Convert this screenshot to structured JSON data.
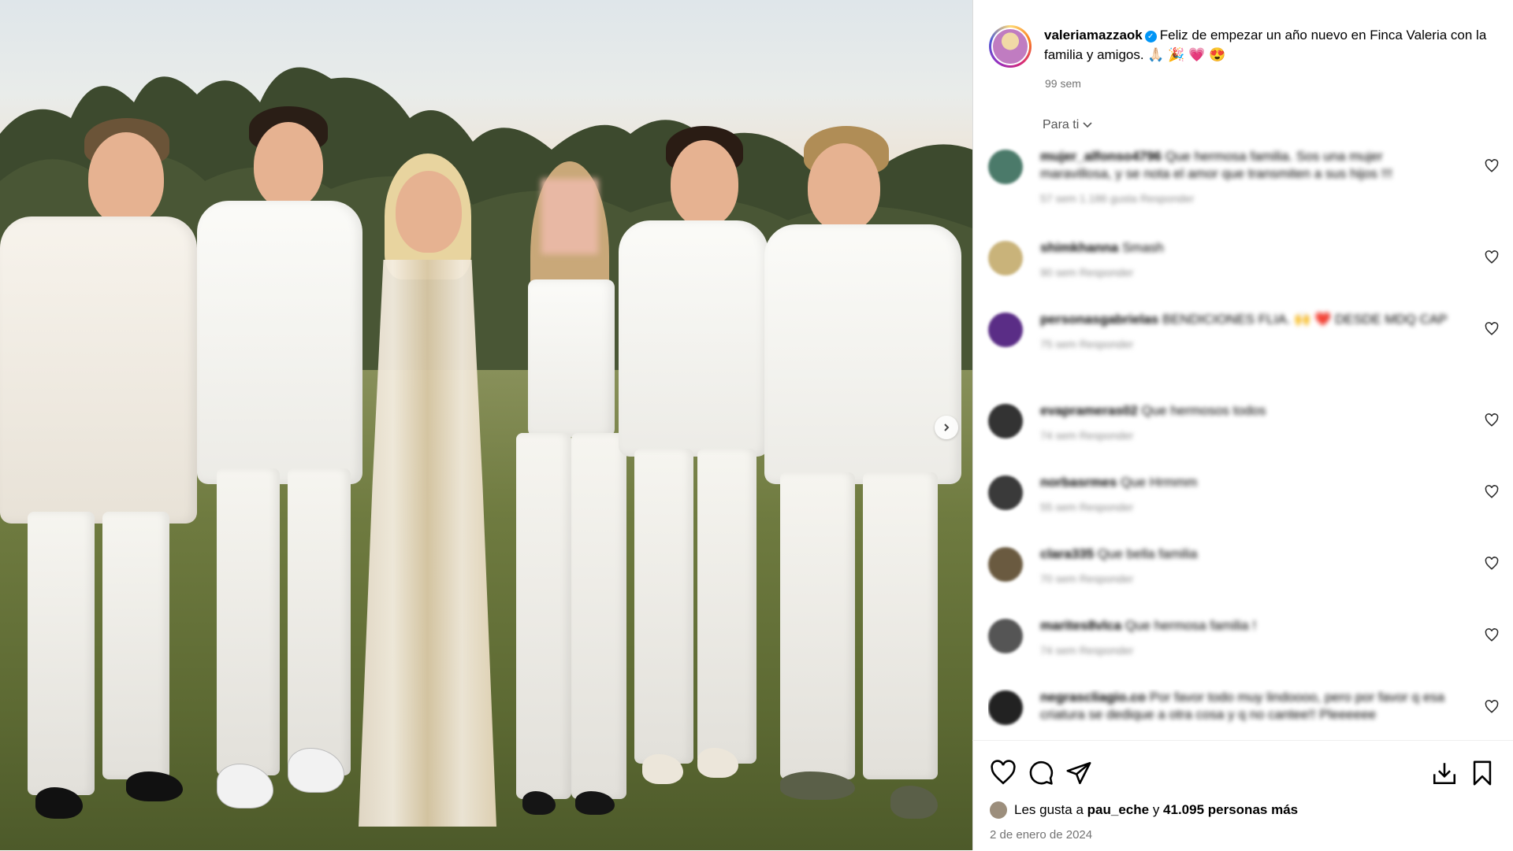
{
  "post": {
    "username": "valeriamazzaok",
    "caption": "Feliz de empezar un año nuevo en Finca Valeria con la familia y amigos. 🙏🏻 🎉 💗 😍",
    "time_ago": "99 sem",
    "sort_label": "Para ti"
  },
  "comments": [
    {
      "user": "mujer_alfonso4796",
      "text": "Que hermosa familia. Sos una mujer maravillosa, y se nota el amor que transmiten a sus hijos !!!",
      "meta": "57 sem   1.186 gusta   Responder",
      "avatar_color": "#4b7a6a"
    },
    {
      "user": "shimkhanna",
      "text": "Smash",
      "meta": "90 sem   Responder",
      "avatar_color": "#c9b37a"
    },
    {
      "user": "personasgabrielas",
      "text": "BENDICIONES FLIA. 🙌 ❤️ DESDE MDQ CAP",
      "meta": "75 sem   Responder",
      "avatar_color": "#5a2d86"
    },
    {
      "user": "evaprameras02",
      "text": "Que hermosos todos",
      "meta": "74 sem   Responder",
      "avatar_color": "#333333"
    },
    {
      "user": "norbasrmes",
      "text": "Que Hrmmm",
      "meta": "55 sem   Responder",
      "avatar_color": "#3a3a3a"
    },
    {
      "user": "clara335",
      "text": "Que bella familia",
      "meta": "70 sem   Responder",
      "avatar_color": "#6a5a40"
    },
    {
      "user": "marites8vlca",
      "text": "Que hermosa familia !",
      "meta": "74 sem   Responder",
      "avatar_color": "#555555"
    },
    {
      "user": "negrascliagio.co",
      "text": "Por favor todo muy lindoooo, pero por favor q esa criatura se dedique a otra cosa y q no cantee!! Pleeeeee",
      "meta": "",
      "avatar_color": "#222222"
    }
  ],
  "likes": {
    "prefix": "Les gusta a",
    "user": "pau_eche",
    "middle": "y",
    "count": "41.095 personas más"
  },
  "date": "2 de enero de 2024",
  "icons": [
    "heart-icon",
    "comment-icon",
    "share-icon",
    "save-download-icon",
    "bookmark-icon",
    "chevron-right-icon",
    "chevron-down-icon",
    "verified-badge-icon"
  ]
}
